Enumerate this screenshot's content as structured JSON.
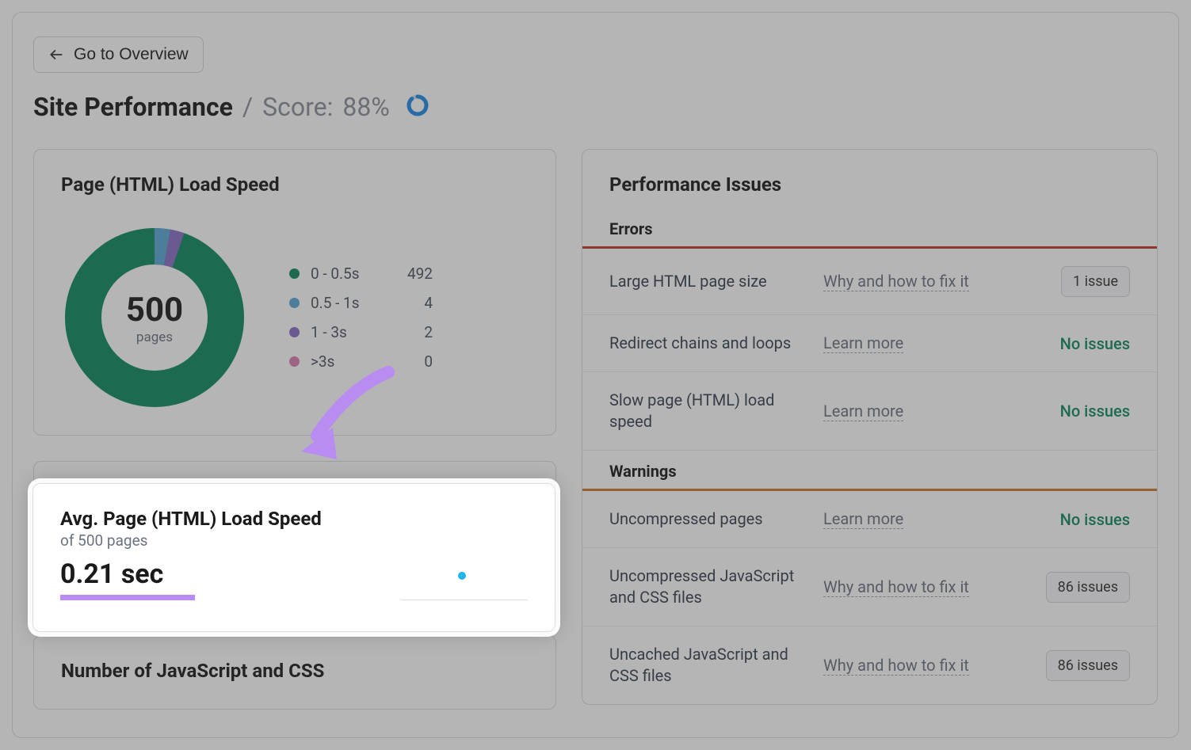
{
  "nav": {
    "back_label": "Go to Overview"
  },
  "header": {
    "title": "Site Performance",
    "separator": "/",
    "score_label": "Score:",
    "score_value": "88%",
    "score_pct": 88
  },
  "load_speed_card": {
    "title": "Page (HTML) Load Speed",
    "total": "500",
    "total_label": "pages",
    "legend": [
      {
        "color": "#0e8a5f",
        "label": "0 - 0.5s",
        "value": "492"
      },
      {
        "color": "#5aa7d6",
        "label": "0.5 - 1s",
        "value": "4"
      },
      {
        "color": "#8a6fc7",
        "label": "1 - 3s",
        "value": "2"
      },
      {
        "color": "#d97fb1",
        "label": ">3s",
        "value": "0"
      }
    ]
  },
  "avg_card": {
    "title": "Avg. Page (HTML) Load Speed",
    "subtitle": "of 500 pages",
    "value": "0.21 sec"
  },
  "jscss_card": {
    "title": "Number of JavaScript and CSS"
  },
  "issues_card": {
    "title": "Performance Issues",
    "errors_label": "Errors",
    "warnings_label": "Warnings",
    "errors": [
      {
        "name": "Large HTML page size",
        "link": "Why and how to fix it",
        "action_type": "badge",
        "action": "1 issue"
      },
      {
        "name": "Redirect chains and loops",
        "link": "Learn more",
        "action_type": "none",
        "action": "No issues"
      },
      {
        "name": "Slow page (HTML) load speed",
        "link": "Learn more",
        "action_type": "none",
        "action": "No issues"
      }
    ],
    "warnings": [
      {
        "name": "Uncompressed pages",
        "link": "Learn more",
        "action_type": "none",
        "action": "No issues"
      },
      {
        "name": "Uncompressed JavaScript and CSS files",
        "link": "Why and how to fix it",
        "action_type": "badge",
        "action": "86 issues"
      },
      {
        "name": "Uncached JavaScript and CSS files",
        "link": "Why and how to fix it",
        "action_type": "badge",
        "action": "86 issues"
      }
    ]
  },
  "chart_data": {
    "type": "pie",
    "title": "Page (HTML) Load Speed",
    "categories": [
      "0 - 0.5s",
      "0.5 - 1s",
      "1 - 3s",
      ">3s"
    ],
    "values": [
      492,
      4,
      2,
      0
    ],
    "colors": [
      "#0e8a5f",
      "#5aa7d6",
      "#8a6fc7",
      "#d97fb1"
    ],
    "total": 500,
    "total_label": "pages"
  }
}
